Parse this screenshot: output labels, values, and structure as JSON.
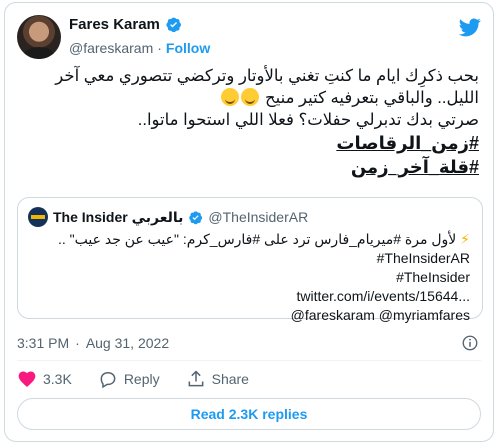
{
  "colors": {
    "accent": "#1d9bf0",
    "like": "#f91880",
    "muted": "#536471"
  },
  "author": {
    "name": "Fares Karam",
    "handle": "@fareskaram",
    "separator": "·",
    "follow_label": "Follow"
  },
  "tweet": {
    "lines": [
      "بحب ذكرِك ايام ما كنتِ تغني بالأوتار وتركضي تتصوري معي آخر",
      "الليل.. والباقي بتعرفيه كتير منيح",
      "صرتي بدك تدبرلي حفلات؟ فعلا اللي استحوا ماتوا..",
      "#زمن_الرقاصات",
      "#قلة_آخر_زمن"
    ]
  },
  "quote": {
    "name": "The Insider بالعربي",
    "handle": "@TheInsiderAR",
    "lines": [
      "لأول مرة #ميريام_فارس ترد على #فارس_كرم: \"عيب عن جد عيب\" ..",
      "#TheInsiderAR",
      "#TheInsider",
      "twitter.com/i/events/15644...",
      "@fareskaram @myriamfares"
    ]
  },
  "meta": {
    "time": "3:31 PM",
    "separator": "·",
    "date": "Aug 31, 2022"
  },
  "actions": {
    "likes": "3.3K",
    "reply_label": "Reply",
    "share_label": "Share"
  },
  "read_replies_label": "Read 2.3K replies"
}
